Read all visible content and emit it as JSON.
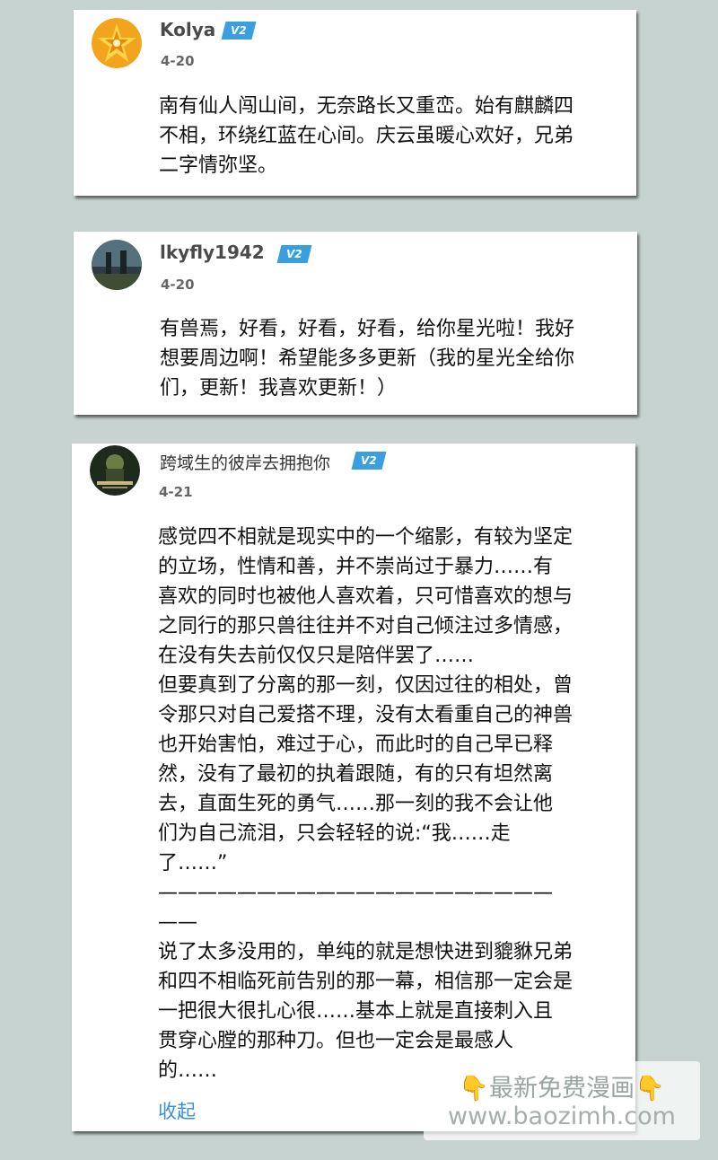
{
  "comments": [
    {
      "username": "Kolya",
      "badge": "V2",
      "date": "4-20",
      "text": "南有仙人闯山间，无奈路长又重峦。始有麒麟四\n不相，环绕红蓝在心间。庆云虽暖心欢好，兄弟\n二字情弥坚。"
    },
    {
      "username": "lkyfly1942",
      "badge": "V2",
      "date": "4-20",
      "text": "有兽焉，好看，好看，好看，给你星光啦！我好\n想要周边啊！希望能多多更新（我的星光全给你\n们，更新！我喜欢更新！）"
    },
    {
      "username": "跨域生的彼岸去拥抱你",
      "badge": "V2",
      "date": "4-21",
      "text": "感觉四不相就是现实中的一个缩影，有较为坚定\n的立场，性情和善，并不崇尚过于暴力……有\n喜欢的同时也被他人喜欢着，只可惜喜欢的想与\n之同行的那只兽往往并不对自己倾注过多情感，\n在没有失去前仅仅只是陪伴罢了……\n但要真到了分离的那一刻，仅因过往的相处，曾\n令那只对自己爱搭不理，没有太看重自己的神兽\n也开始害怕，难过于心，而此时的自己早已释\n然，没有了最初的执着跟随，有的只有坦然离\n去，直面生死的勇气……那一刻的我不会让他\n们为自己流泪，只会轻轻的说:“我……走\n了……”\n————————————————————\n——\n说了太多没用的，单纯的就是想快进到貔貅兄弟\n和四不相临死前告别的那一幕，相信那一定会是\n一把很大很扎心很……基本上就是直接刺入且\n贯穿心膛的那种刀。但也一定会是最感人\n的……",
      "collapse_label": "收起"
    }
  ],
  "watermark": {
    "line1": "👇最新免费漫画👇",
    "line2": "www.baozimh.com"
  },
  "colors": {
    "background": "#c7d3d0",
    "badge": "#3a9fe0",
    "link": "#3b8fd8"
  }
}
